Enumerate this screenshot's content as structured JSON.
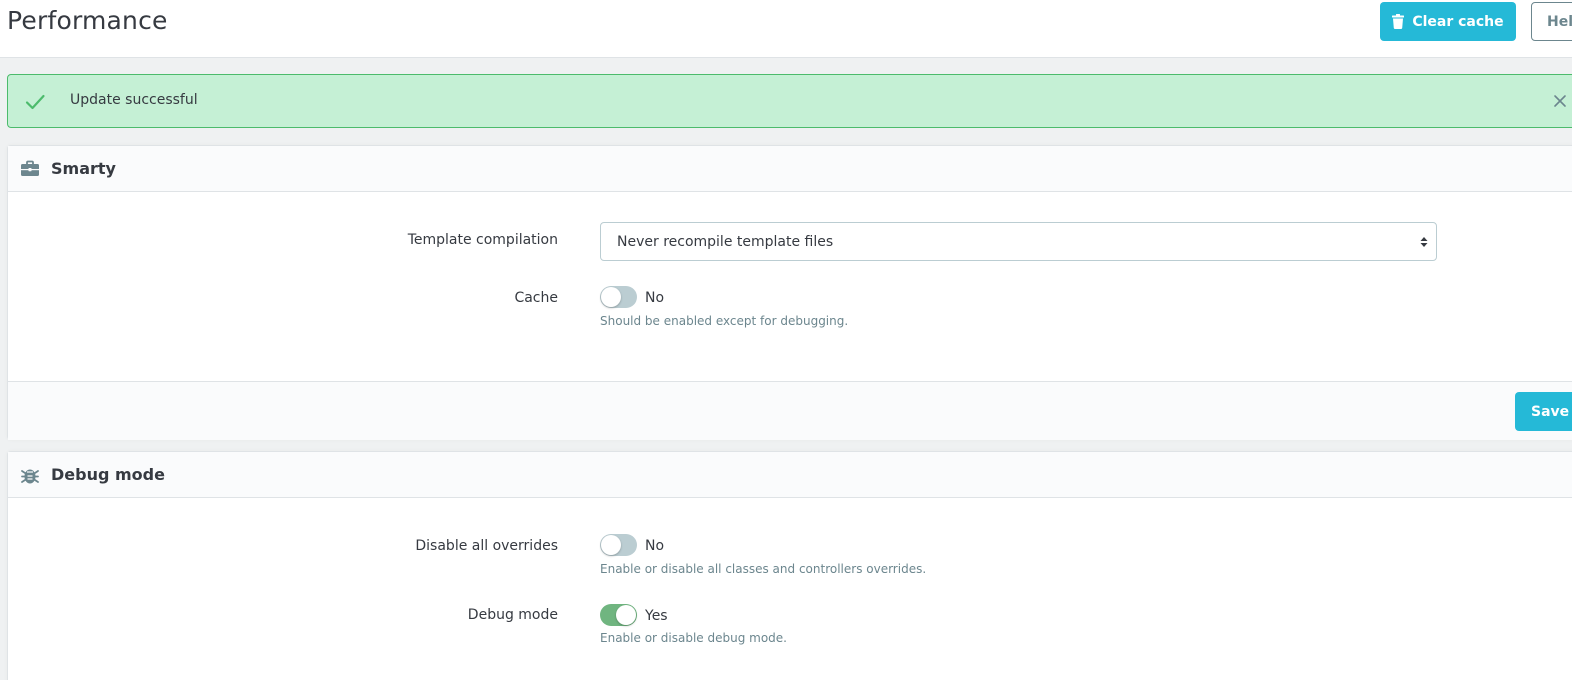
{
  "header": {
    "title": "Performance",
    "clear_cache_label": "Clear cache",
    "help_label": "Help",
    "accent_color": "#25b9d7"
  },
  "alert": {
    "message": "Update successful",
    "type": "success",
    "icon": "check-icon",
    "close_icon": "close-icon"
  },
  "smarty": {
    "title": "Smarty",
    "icon": "briefcase-icon",
    "template_compilation": {
      "label": "Template compilation",
      "selected": "Never recompile template files"
    },
    "cache": {
      "label": "Cache",
      "enabled": false,
      "state_text": "No",
      "help": "Should be enabled except for debugging."
    },
    "save_label": "Save"
  },
  "debug": {
    "title": "Debug mode",
    "icon": "bug-icon",
    "disable_overrides": {
      "label": "Disable all overrides",
      "enabled": false,
      "state_text": "No",
      "help": "Enable or disable all classes and controllers overrides."
    },
    "debug_mode": {
      "label": "Debug mode",
      "enabled": true,
      "state_text": "Yes",
      "help": "Enable or disable debug mode."
    }
  }
}
